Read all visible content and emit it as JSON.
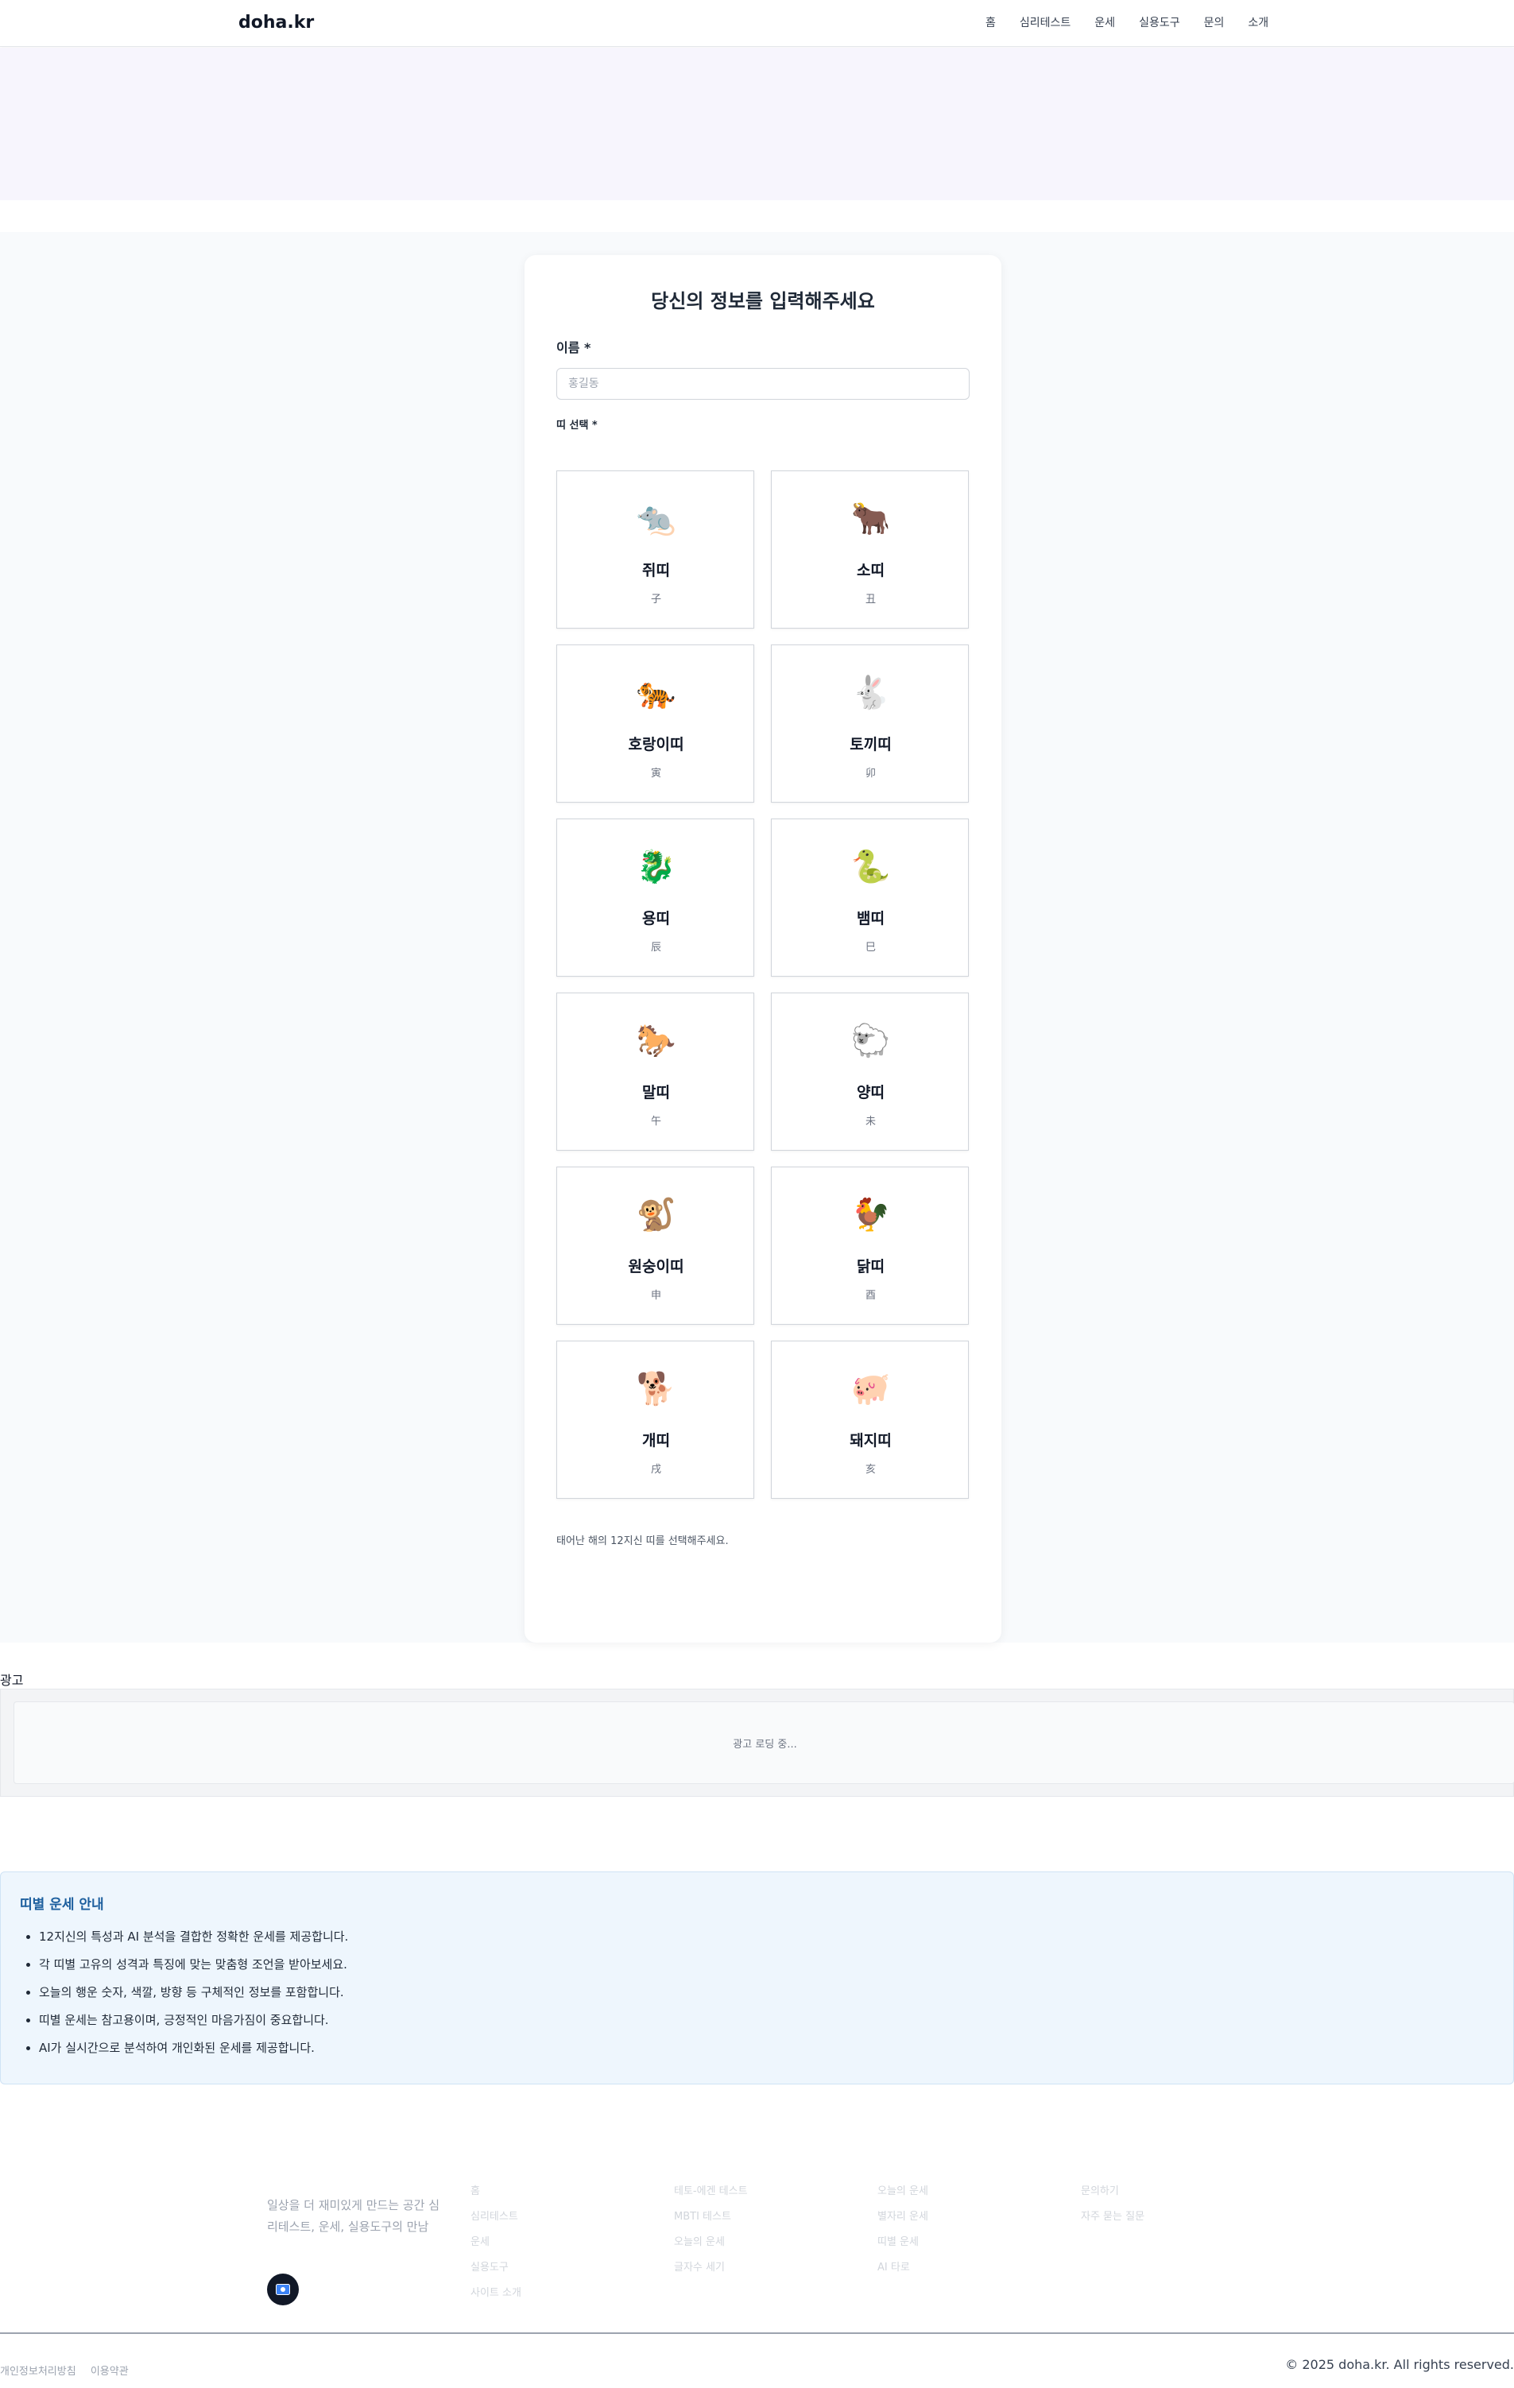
{
  "header": {
    "logo": "doha.kr",
    "nav": [
      "홈",
      "심리테스트",
      "운세",
      "실용도구",
      "문의",
      "소개"
    ]
  },
  "form": {
    "title": "당신의 정보를 입력해주세요",
    "name_label": "이름 *",
    "name_placeholder": "홍길동",
    "zodiac_label": "띠 선택 *",
    "hint": "태어난 해의 12지신 띠를 선택해주세요."
  },
  "zodiacs": [
    {
      "icon": "rat-icon",
      "emoji": "🐀",
      "name": "쥐띠",
      "hanja": "子"
    },
    {
      "icon": "ox-icon",
      "emoji": "🐂",
      "name": "소띠",
      "hanja": "丑"
    },
    {
      "icon": "tiger-icon",
      "emoji": "🐅",
      "name": "호랑이띠",
      "hanja": "寅"
    },
    {
      "icon": "rabbit-icon",
      "emoji": "🐇",
      "name": "토끼띠",
      "hanja": "卯"
    },
    {
      "icon": "dragon-icon",
      "emoji": "🐉",
      "name": "용띠",
      "hanja": "辰"
    },
    {
      "icon": "snake-icon",
      "emoji": "🐍",
      "name": "뱀띠",
      "hanja": "巳"
    },
    {
      "icon": "horse-icon",
      "emoji": "🐎",
      "name": "말띠",
      "hanja": "午"
    },
    {
      "icon": "sheep-icon",
      "emoji": "🐑",
      "name": "양띠",
      "hanja": "未"
    },
    {
      "icon": "monkey-icon",
      "emoji": "🐒",
      "name": "원숭이띠",
      "hanja": "申"
    },
    {
      "icon": "rooster-icon",
      "emoji": "🐓",
      "name": "닭띠",
      "hanja": "酉"
    },
    {
      "icon": "dog-icon",
      "emoji": "🐕",
      "name": "개띠",
      "hanja": "戌"
    },
    {
      "icon": "pig-icon",
      "emoji": "🐖",
      "name": "돼지띠",
      "hanja": "亥"
    }
  ],
  "ad": {
    "label": "광고",
    "loading": "광고 로딩 중..."
  },
  "info": {
    "title": "띠별 운세 안내",
    "items": [
      "12지신의 특성과 AI 분석을 결합한 정확한 운세를 제공합니다.",
      "각 띠별 고유의 성격과 특징에 맞는 맞춤형 조언을 받아보세요.",
      "오늘의 행운 숫자, 색깔, 방향 등 구체적인 정보를 포함합니다.",
      "띠별 운세는 참고용이며, 긍정적인 마음가짐이 중요합니다.",
      "AI가 실시간으로 분석하여 개인화된 운세를 제공합니다."
    ]
  },
  "footer": {
    "description": "일상을 더 재미있게 만드는 공간 심리테스트, 운세, 실용도구의 만남",
    "columns": [
      [
        "홈",
        "심리테스트",
        "운세",
        "실용도구",
        "사이트 소개"
      ],
      [
        "테토-에겐 테스트",
        "MBTI 테스트",
        "오늘의 운세",
        "글자수 세기"
      ],
      [
        "오늘의 운세",
        "별자리 운세",
        "띠별 운세",
        "AI 타로"
      ],
      [
        "문의하기",
        "자주 묻는 질문"
      ]
    ],
    "legal": [
      "개인정보처리방침",
      "이용약관"
    ],
    "copyright": "© 2025 doha.kr. All rights reserved."
  }
}
